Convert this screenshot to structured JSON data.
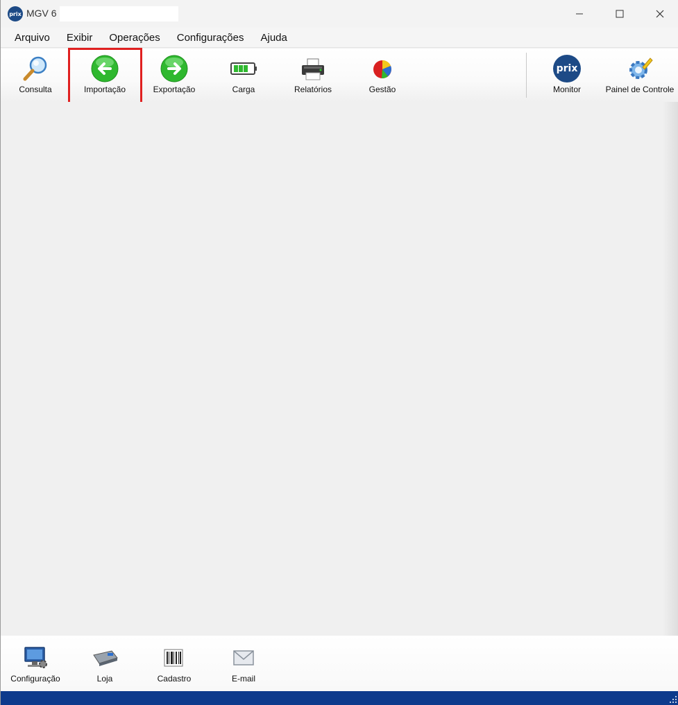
{
  "window": {
    "app_icon_text": "prix",
    "title": "MGV 6"
  },
  "menu": [
    {
      "label": "Arquivo"
    },
    {
      "label": "Exibir"
    },
    {
      "label": "Operações"
    },
    {
      "label": "Configurações"
    },
    {
      "label": "Ajuda"
    }
  ],
  "toolbar": {
    "consulta": "Consulta",
    "importacao": "Importação",
    "exportacao": "Exportação",
    "carga": "Carga",
    "relatorios": "Relatórios",
    "gestao": "Gestão",
    "monitor": "Monitor",
    "monitor_icon_text": "prix",
    "painel": "Painel de Controle"
  },
  "bottombar": {
    "configuracao": "Configuração",
    "loja": "Loja",
    "cadastro": "Cadastro",
    "email": "E-mail"
  },
  "colors": {
    "highlight": "#e02020",
    "statusbar": "#0d3a8c",
    "green_button": "#2fb82f",
    "prix_blue": "#1d4a86"
  }
}
